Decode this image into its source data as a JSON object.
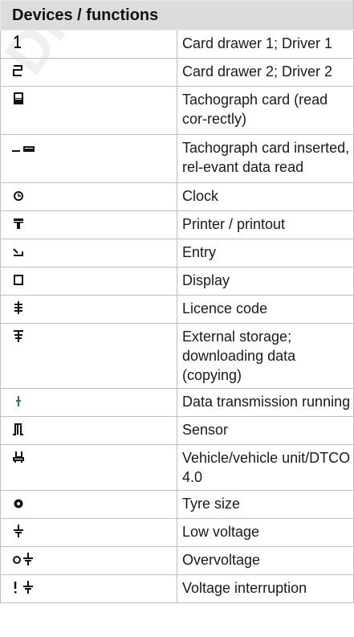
{
  "header": {
    "title": "Devices / functions"
  },
  "rows": [
    {
      "icon": "card-drawer-1-icon",
      "description": "Card drawer 1; Driver 1"
    },
    {
      "icon": "card-drawer-2-icon",
      "description": "Card drawer 2; Driver 2"
    },
    {
      "icon": "tachograph-card-read-icon",
      "description": "Tachograph card (read cor-rectly)"
    },
    {
      "icon": "tachograph-card-inserted-icon",
      "description": "Tachograph card inserted, rel-evant data read"
    },
    {
      "icon": "clock-icon",
      "description": "Clock"
    },
    {
      "icon": "printer-icon",
      "description": "Printer / printout"
    },
    {
      "icon": "entry-icon",
      "description": "Entry"
    },
    {
      "icon": "display-icon",
      "description": "Display"
    },
    {
      "icon": "licence-code-icon",
      "description": "Licence code"
    },
    {
      "icon": "external-storage-icon",
      "description": "External storage; downloading data (copying)"
    },
    {
      "icon": "data-transmission-icon",
      "description": "Data transmission running"
    },
    {
      "icon": "sensor-icon",
      "description": "Sensor"
    },
    {
      "icon": "vehicle-unit-icon",
      "description": "Vehicle/vehicle unit/DTCO 4.0"
    },
    {
      "icon": "tyre-size-icon",
      "description": "Tyre size"
    },
    {
      "icon": "low-voltage-icon",
      "description": "Low voltage"
    },
    {
      "icon": "overvoltage-icon",
      "description": "Overvoltage"
    },
    {
      "icon": "voltage-interruption-icon",
      "description": "Voltage interruption"
    }
  ]
}
